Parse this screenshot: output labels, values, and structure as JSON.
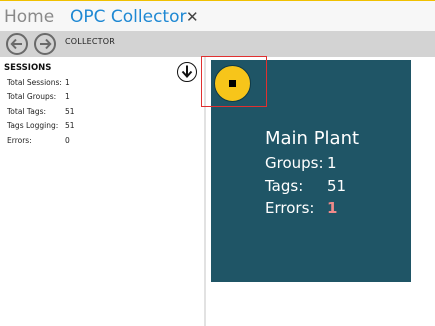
{
  "tabs": {
    "home_label": "Home",
    "collector_label": "OPC Collector",
    "close_symbol": "✕"
  },
  "toolbar": {
    "title": "COLLECTOR",
    "back_icon": "arrow-left-circle",
    "forward_icon": "arrow-right-circle"
  },
  "sessions": {
    "header": "SESSIONS",
    "stats": [
      {
        "label": "Total Sessions:",
        "value": "1"
      },
      {
        "label": "Total Groups:",
        "value": "1"
      },
      {
        "label": "Total Tags:",
        "value": "51"
      },
      {
        "label": "Tags Logging:",
        "value": "51"
      },
      {
        "label": "Errors:",
        "value": "0"
      }
    ],
    "download_icon": "arrow-down-circle"
  },
  "plant": {
    "title": "Main Plant",
    "groups_label": "Groups:",
    "groups_value": "1",
    "tags_label": "Tags:",
    "tags_value": "51",
    "errors_label": "Errors:",
    "errors_value": "1",
    "tile_color": "#1f5566",
    "stop_button_color": "#f7c51a",
    "error_color": "#f08a8a"
  },
  "colors": {
    "accent_tab": "#1e88d3",
    "toolbar_bg": "#d3d3d3",
    "highlight": "#e03030"
  }
}
